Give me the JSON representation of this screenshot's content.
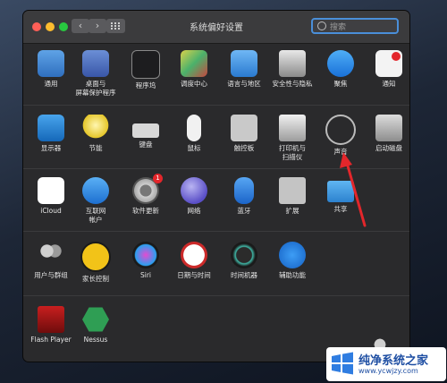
{
  "window": {
    "title": "系统偏好设置"
  },
  "search": {
    "placeholder": "搜索"
  },
  "nav": {
    "back": "‹",
    "forward": "›"
  },
  "rows": [
    [
      {
        "name": "general",
        "label": "通用",
        "icon": "general-icon"
      },
      {
        "name": "desktop-screensaver",
        "label": "桌面与\n屏幕保护程序",
        "icon": "desktop-icon"
      },
      {
        "name": "dock",
        "label": "程序坞",
        "icon": "dock-icon"
      },
      {
        "name": "mission-control",
        "label": "调度中心",
        "icon": "mission-control-icon"
      },
      {
        "name": "language-region",
        "label": "语言与地区",
        "icon": "flag-icon"
      },
      {
        "name": "security-privacy",
        "label": "安全性与隐私",
        "icon": "house-icon"
      },
      {
        "name": "spotlight",
        "label": "聚焦",
        "icon": "spotlight-icon"
      },
      {
        "name": "notifications",
        "label": "通知",
        "icon": "notification-icon"
      }
    ],
    [
      {
        "name": "displays",
        "label": "显示器",
        "icon": "display-icon"
      },
      {
        "name": "energy-saver",
        "label": "节能",
        "icon": "lightbulb-icon"
      },
      {
        "name": "keyboard",
        "label": "键盘",
        "icon": "keyboard-icon"
      },
      {
        "name": "mouse",
        "label": "鼠标",
        "icon": "mouse-icon"
      },
      {
        "name": "trackpad",
        "label": "触控板",
        "icon": "trackpad-icon"
      },
      {
        "name": "printers-scanners",
        "label": "打印机与\n扫描仪",
        "icon": "printer-icon"
      },
      {
        "name": "sound",
        "label": "声音",
        "icon": "speaker-icon"
      },
      {
        "name": "startup-disk",
        "label": "启动磁盘",
        "icon": "disk-icon"
      }
    ],
    [
      {
        "name": "icloud",
        "label": "iCloud",
        "icon": "cloud-icon"
      },
      {
        "name": "internet-accounts",
        "label": "互联网\n帐户",
        "icon": "at-icon"
      },
      {
        "name": "software-update",
        "label": "软件更新",
        "icon": "gear-icon"
      },
      {
        "name": "network",
        "label": "网络",
        "icon": "globe-icon"
      },
      {
        "name": "bluetooth",
        "label": "蓝牙",
        "icon": "bluetooth-icon"
      },
      {
        "name": "extensions",
        "label": "扩展",
        "icon": "puzzle-icon"
      },
      {
        "name": "sharing",
        "label": "共享",
        "icon": "folder-icon"
      }
    ],
    [
      {
        "name": "users-groups",
        "label": "用户与群组",
        "icon": "users-icon"
      },
      {
        "name": "parental-controls",
        "label": "家长控制",
        "icon": "parental-icon"
      },
      {
        "name": "siri",
        "label": "Siri",
        "icon": "siri-icon"
      },
      {
        "name": "date-time",
        "label": "日期与时间",
        "icon": "clock-icon"
      },
      {
        "name": "time-machine",
        "label": "时间机器",
        "icon": "time-machine-icon"
      },
      {
        "name": "accessibility",
        "label": "辅助功能",
        "icon": "accessibility-icon"
      }
    ],
    [
      {
        "name": "flash-player",
        "label": "Flash Player",
        "icon": "flash-icon"
      },
      {
        "name": "nessus",
        "label": "Nessus",
        "icon": "nessus-icon"
      }
    ]
  ],
  "badge": {
    "software_update": "1"
  },
  "watermark": {
    "title": "纯净系统之家",
    "url": "www.ycwjzy.com"
  },
  "colors": {
    "accent": "#4a8fd9",
    "arrow": "#e3262b",
    "window_bg": "#2a2a2c"
  }
}
